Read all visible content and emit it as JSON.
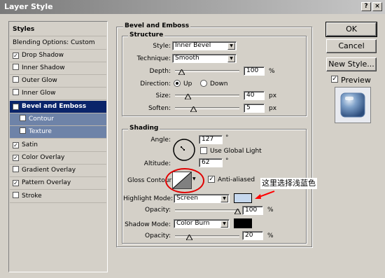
{
  "window": {
    "title": "Layer Style",
    "help_btn": "?",
    "close_btn": "×"
  },
  "styles_list": {
    "items": [
      {
        "label": "Styles",
        "checkbox": false,
        "checked": false,
        "state": "normal",
        "bold": true
      },
      {
        "label": "Blending Options: Custom",
        "checkbox": false,
        "checked": false,
        "state": "normal"
      },
      {
        "label": "Drop Shadow",
        "checkbox": true,
        "checked": true,
        "state": "normal"
      },
      {
        "label": "Inner Shadow",
        "checkbox": true,
        "checked": false,
        "state": "normal"
      },
      {
        "label": "Outer Glow",
        "checkbox": true,
        "checked": false,
        "state": "normal"
      },
      {
        "label": "Inner Glow",
        "checkbox": true,
        "checked": false,
        "state": "normal"
      },
      {
        "label": "Bevel and Emboss",
        "checkbox": true,
        "checked": true,
        "state": "selected"
      },
      {
        "label": "Contour",
        "checkbox": true,
        "checked": false,
        "state": "sub"
      },
      {
        "label": "Texture",
        "checkbox": true,
        "checked": false,
        "state": "sub"
      },
      {
        "label": "Satin",
        "checkbox": true,
        "checked": true,
        "state": "normal"
      },
      {
        "label": "Color Overlay",
        "checkbox": true,
        "checked": true,
        "state": "normal"
      },
      {
        "label": "Gradient Overlay",
        "checkbox": true,
        "checked": false,
        "state": "normal"
      },
      {
        "label": "Pattern Overlay",
        "checkbox": true,
        "checked": true,
        "state": "normal"
      },
      {
        "label": "Stroke",
        "checkbox": true,
        "checked": false,
        "state": "normal"
      }
    ]
  },
  "bevel": {
    "group_title": "Bevel and Emboss",
    "structure_title": "Structure",
    "style_label": "Style:",
    "style_value": "Inner Bevel",
    "technique_label": "Technique:",
    "technique_value": "Smooth",
    "depth_label": "Depth:",
    "depth_value": "100",
    "depth_unit": "%",
    "direction_label": "Direction:",
    "direction_up": "Up",
    "direction_down": "Down",
    "size_label": "Size:",
    "size_value": "40",
    "size_unit": "px",
    "soften_label": "Soften:",
    "soften_value": "5",
    "soften_unit": "px"
  },
  "shading": {
    "title": "Shading",
    "angle_label": "Angle:",
    "angle_value": "127",
    "angle_unit": "°",
    "global_light_label": "Use Global Light",
    "altitude_label": "Altitude:",
    "altitude_value": "62",
    "altitude_unit": "°",
    "gloss_label": "Gloss Contour:",
    "anti_aliased_label": "Anti-aliased",
    "highlight_mode_label": "Highlight Mode:",
    "highlight_mode_value": "Screen",
    "highlight_color": "#c6d8ee",
    "highlight_opacity_label": "Opacity:",
    "highlight_opacity_value": "100",
    "highlight_opacity_unit": "%",
    "shadow_mode_label": "Shadow Mode:",
    "shadow_mode_value": "Color Burn",
    "shadow_color": "#000000",
    "shadow_opacity_label": "Opacity:",
    "shadow_opacity_value": "20",
    "shadow_opacity_unit": "%"
  },
  "annotation": {
    "text": "这里选择浅蓝色",
    "color": "#ff0000"
  },
  "buttons": {
    "ok": "OK",
    "cancel": "Cancel",
    "new_style": "New Style...",
    "preview": "Preview"
  }
}
